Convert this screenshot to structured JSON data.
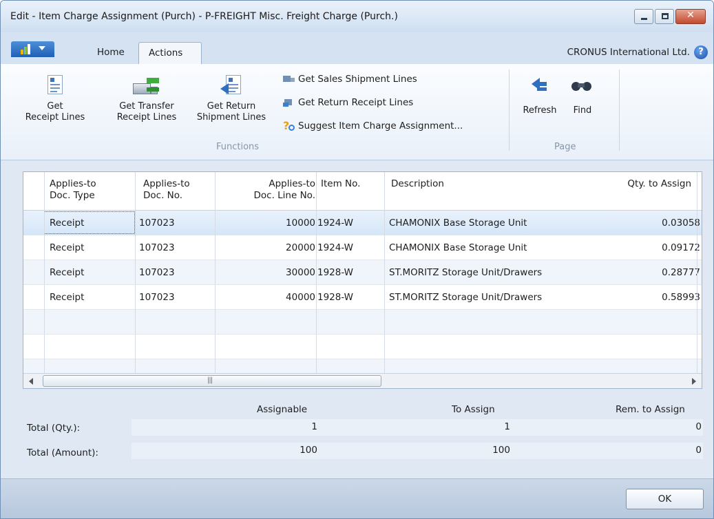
{
  "window": {
    "title": "Edit - Item Charge Assignment (Purch) - P-FREIGHT Misc. Freight Charge (Purch.)"
  },
  "tabs": {
    "home": "Home",
    "actions": "Actions"
  },
  "company": "CRONUS International Ltd.",
  "ribbon": {
    "functions": {
      "label": "Functions",
      "get_receipt_lines": [
        "Get",
        "Receipt Lines"
      ],
      "get_transfer_receipt_lines": [
        "Get Transfer",
        "Receipt Lines"
      ],
      "get_return_shipment_lines": [
        "Get Return",
        "Shipment Lines"
      ],
      "get_sales_shipment_lines": "Get Sales Shipment Lines",
      "get_return_receipt_lines": "Get Return Receipt Lines",
      "suggest_item_charge_assignment": "Suggest Item Charge Assignment..."
    },
    "page": {
      "label": "Page",
      "refresh": "Refresh",
      "find": "Find"
    }
  },
  "grid": {
    "columns": {
      "doc_type": [
        "Applies-to",
        "Doc. Type"
      ],
      "doc_no": [
        "Applies-to",
        "Doc. No."
      ],
      "doc_line_no": [
        "Applies-to",
        "Doc. Line No."
      ],
      "item_no": "Item No.",
      "description": "Description",
      "qty_to_assign": "Qty. to Assign"
    },
    "rows": [
      {
        "doc_type": "Receipt",
        "doc_no": "107023",
        "line_no": "10000",
        "item_no": "1924-W",
        "description": "CHAMONIX Base Storage Unit",
        "qty": "0.03058"
      },
      {
        "doc_type": "Receipt",
        "doc_no": "107023",
        "line_no": "20000",
        "item_no": "1924-W",
        "description": "CHAMONIX Base Storage Unit",
        "qty": "0.09172"
      },
      {
        "doc_type": "Receipt",
        "doc_no": "107023",
        "line_no": "30000",
        "item_no": "1928-W",
        "description": "ST.MORITZ Storage Unit/Drawers",
        "qty": "0.28777"
      },
      {
        "doc_type": "Receipt",
        "doc_no": "107023",
        "line_no": "40000",
        "item_no": "1928-W",
        "description": "ST.MORITZ Storage Unit/Drawers",
        "qty": "0.58993"
      }
    ]
  },
  "totals": {
    "headers": {
      "assignable": "Assignable",
      "to_assign": "To Assign",
      "rem_to_assign": "Rem. to Assign"
    },
    "qty": {
      "label": "Total (Qty.):",
      "assignable": "1",
      "to_assign": "1",
      "rem_to_assign": "0"
    },
    "amount": {
      "label": "Total (Amount):",
      "assignable": "100",
      "to_assign": "100",
      "rem_to_assign": "0"
    }
  },
  "footer": {
    "ok": "OK"
  }
}
